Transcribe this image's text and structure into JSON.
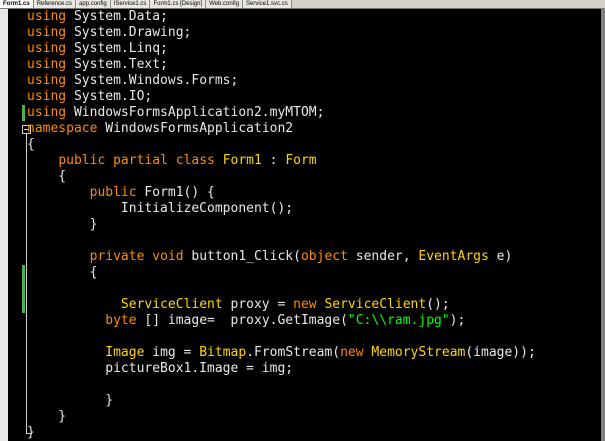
{
  "tabs": [
    {
      "label": "Form1.cs",
      "active": true
    },
    {
      "label": "Reference.cs",
      "active": false
    },
    {
      "label": "app.config",
      "active": false
    },
    {
      "label": "IService1.cs",
      "active": false
    },
    {
      "label": "Form1.cs [Design]",
      "active": false
    },
    {
      "label": "Web.config",
      "active": false
    },
    {
      "label": "Service1.svc.cs",
      "active": false
    }
  ],
  "colors": {
    "keyword": "#ff8c00",
    "type": "#ffd700",
    "text": "#e8e8e8",
    "string": "#00ff00",
    "background": "#000000",
    "change_marker": "#4caf50"
  },
  "code": {
    "lines": [
      [
        {
          "t": "using",
          "c": "kw"
        },
        {
          "t": " System.Data;",
          "c": "tx"
        }
      ],
      [
        {
          "t": "using",
          "c": "kw"
        },
        {
          "t": " System.Drawing;",
          "c": "tx"
        }
      ],
      [
        {
          "t": "using",
          "c": "kw"
        },
        {
          "t": " System.Linq;",
          "c": "tx"
        }
      ],
      [
        {
          "t": "using",
          "c": "kw"
        },
        {
          "t": " System.Text;",
          "c": "tx"
        }
      ],
      [
        {
          "t": "using",
          "c": "kw"
        },
        {
          "t": " System.Windows.Forms;",
          "c": "tx"
        }
      ],
      [
        {
          "t": "using",
          "c": "kw"
        },
        {
          "t": " System.IO;",
          "c": "tx"
        }
      ],
      [
        {
          "t": "using",
          "c": "kw"
        },
        {
          "t": " WindowsFormsApplication2.myMTOM;",
          "c": "tx"
        }
      ],
      [
        {
          "t": "namespace",
          "c": "kw"
        },
        {
          "t": " WindowsFormsApplication2",
          "c": "tx"
        }
      ],
      [
        {
          "t": "{",
          "c": "tx"
        }
      ],
      [
        {
          "t": "    ",
          "c": "tx"
        },
        {
          "t": "public",
          "c": "kw"
        },
        {
          "t": " ",
          "c": "tx"
        },
        {
          "t": "partial",
          "c": "kw"
        },
        {
          "t": " ",
          "c": "tx"
        },
        {
          "t": "class",
          "c": "kw"
        },
        {
          "t": " ",
          "c": "tx"
        },
        {
          "t": "Form1",
          "c": "ty"
        },
        {
          "t": " : ",
          "c": "tx"
        },
        {
          "t": "Form",
          "c": "ty"
        }
      ],
      [
        {
          "t": "    {",
          "c": "tx"
        }
      ],
      [
        {
          "t": "        ",
          "c": "tx"
        },
        {
          "t": "public",
          "c": "kw"
        },
        {
          "t": " Form1() {",
          "c": "tx"
        }
      ],
      [
        {
          "t": "            InitializeComponent();",
          "c": "tx"
        }
      ],
      [
        {
          "t": "        }",
          "c": "tx"
        }
      ],
      [
        {
          "t": "",
          "c": "tx"
        }
      ],
      [
        {
          "t": "        ",
          "c": "tx"
        },
        {
          "t": "private",
          "c": "kw"
        },
        {
          "t": " ",
          "c": "tx"
        },
        {
          "t": "void",
          "c": "kw"
        },
        {
          "t": " button1_Click(",
          "c": "tx"
        },
        {
          "t": "object",
          "c": "kw"
        },
        {
          "t": " sender, ",
          "c": "tx"
        },
        {
          "t": "EventArgs",
          "c": "ty"
        },
        {
          "t": " e)",
          "c": "tx"
        }
      ],
      [
        {
          "t": "        {",
          "c": "tx"
        }
      ],
      [
        {
          "t": "",
          "c": "tx"
        }
      ],
      [
        {
          "t": "            ",
          "c": "tx"
        },
        {
          "t": "ServiceClient",
          "c": "ty"
        },
        {
          "t": " proxy = ",
          "c": "tx"
        },
        {
          "t": "new",
          "c": "kw"
        },
        {
          "t": " ",
          "c": "tx"
        },
        {
          "t": "ServiceClient",
          "c": "ty"
        },
        {
          "t": "();",
          "c": "tx"
        }
      ],
      [
        {
          "t": "          ",
          "c": "tx"
        },
        {
          "t": "byte",
          "c": "kw"
        },
        {
          "t": " [] image=  proxy.GetImage(",
          "c": "tx"
        },
        {
          "t": "\"C:\\\\ram.jpg\"",
          "c": "st"
        },
        {
          "t": ");",
          "c": "tx"
        }
      ],
      [
        {
          "t": "",
          "c": "tx"
        }
      ],
      [
        {
          "t": "          ",
          "c": "tx"
        },
        {
          "t": "Image",
          "c": "ty"
        },
        {
          "t": " img = ",
          "c": "tx"
        },
        {
          "t": "Bitmap",
          "c": "ty"
        },
        {
          "t": ".FromStream(",
          "c": "tx"
        },
        {
          "t": "new",
          "c": "kw"
        },
        {
          "t": " ",
          "c": "tx"
        },
        {
          "t": "MemoryStream",
          "c": "ty"
        },
        {
          "t": "(image));",
          "c": "tx"
        }
      ],
      [
        {
          "t": "          pictureBox1.Image = img;",
          "c": "tx"
        }
      ],
      [
        {
          "t": "",
          "c": "tx"
        }
      ],
      [
        {
          "t": "          }",
          "c": "tx"
        }
      ],
      [
        {
          "t": "    }",
          "c": "tx"
        }
      ],
      [
        {
          "t": "}",
          "c": "tx"
        }
      ]
    ]
  }
}
